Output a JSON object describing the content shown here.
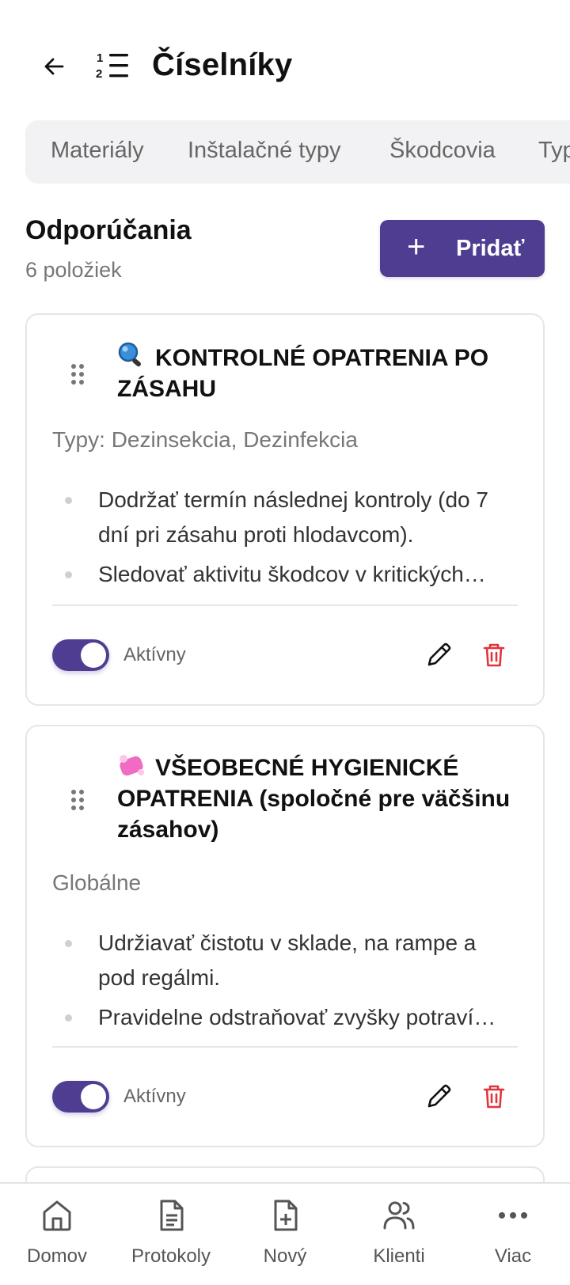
{
  "header": {
    "back_icon": "arrow-left-icon",
    "list_icon": "numbered-list-icon",
    "title": "Číselníky"
  },
  "tabs": [
    {
      "label": "Materiály"
    },
    {
      "label": "Inštalačné typy"
    },
    {
      "label": "Škodcovia"
    },
    {
      "label": "Typ"
    }
  ],
  "section": {
    "title": "Odporúčania",
    "count": "6 položiek",
    "add_label": "Pridať",
    "add_icon": "plus-icon"
  },
  "cards": [
    {
      "emoji": "magnifying-glass-icon",
      "title": "KONTROLNÉ OPATRENIA PO ZÁSAHU",
      "meta": "Typy: Dezinsekcia, Dezinfekcia",
      "items": [
        "Dodržať termín následnej kontroly (do 7 dní pri zásahu proti hlodavcom).",
        "Sledovať aktivitu škodcov v kritických…"
      ],
      "status": "Aktívny",
      "active": true
    },
    {
      "emoji": "soap-icon",
      "title": "VŠEOBECNÉ HYGIENICKÉ OPATRENIA (spoločné pre väčšinu zásahov)",
      "meta": "Globálne",
      "items": [
        "Udržiavať čistotu v sklade, na rampe a pod regálmi.",
        "Pravidelne odstraňovať zvyšky potraví…"
      ],
      "status": "Aktívny",
      "active": true
    }
  ],
  "nav": [
    {
      "label": "Domov",
      "icon": "home-icon"
    },
    {
      "label": "Protokoly",
      "icon": "document-icon"
    },
    {
      "label": "Nový",
      "icon": "file-plus-icon"
    },
    {
      "label": "Klienti",
      "icon": "users-icon"
    },
    {
      "label": "Viac",
      "icon": "more-dots-icon"
    }
  ],
  "colors": {
    "accent": "#4f3d92",
    "delete": "#e0353b",
    "tab_bg": "#f2f2f4"
  }
}
